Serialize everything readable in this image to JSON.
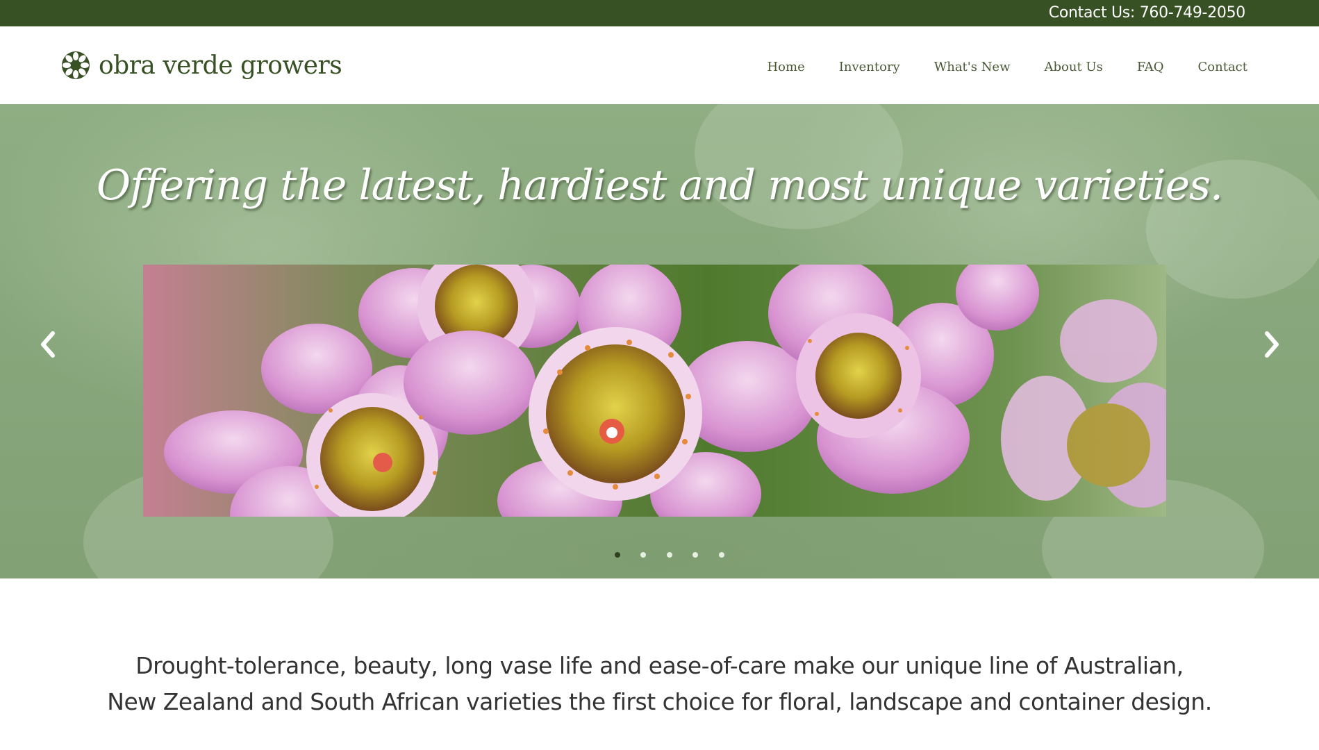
{
  "topbar": {
    "contact": "Contact Us: 760-749-2050",
    "background": "#375124"
  },
  "brand": {
    "name": "obra verde growers",
    "logo_icon": "flower-rosette-icon",
    "color": "#375124"
  },
  "nav": {
    "items": [
      {
        "label": "Home"
      },
      {
        "label": "Inventory"
      },
      {
        "label": "What's New"
      },
      {
        "label": "About Us"
      },
      {
        "label": "FAQ"
      },
      {
        "label": "Contact"
      }
    ]
  },
  "hero": {
    "tagline": "Offering the latest, hardiest and most unique varieties.",
    "prev_icon": "chevron-left-icon",
    "next_icon": "chevron-right-icon",
    "slide_count": 5,
    "active_slide": 1,
    "image_subject": "pink waxflower blossoms"
  },
  "intro": {
    "line1": "Drought-tolerance, beauty, long vase life and ease-of-care make our unique line of Australian,",
    "line2": "New Zealand and South African varieties the first choice for floral, landscape and container design."
  }
}
